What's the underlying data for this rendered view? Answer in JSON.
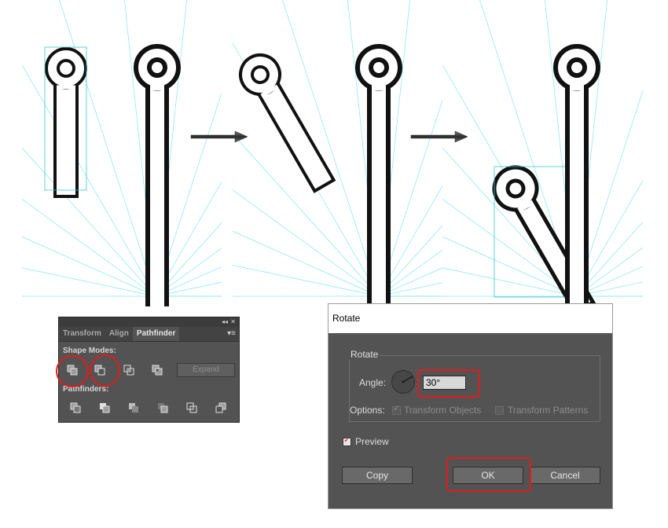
{
  "pathfinder_panel": {
    "tabs": [
      "Transform",
      "Align",
      "Pathfinder"
    ],
    "active_tab": "Pathfinder",
    "shape_modes_label": "Shape Modes:",
    "pathfinders_label": "Pathfinders:",
    "expand_label": "Expand",
    "shape_mode_icons": [
      "unite-icon",
      "minus-front-icon",
      "intersect-icon",
      "exclude-icon"
    ],
    "pathfinder_icons": [
      "divide-icon",
      "trim-icon",
      "merge-icon",
      "crop-icon",
      "outline-icon",
      "minus-back-icon"
    ]
  },
  "rotate_dialog": {
    "title": "Rotate",
    "group_label": "Rotate",
    "angle_label": "Angle:",
    "angle_value": "30°",
    "options_label": "Options:",
    "transform_objects_label": "Transform Objects",
    "transform_objects_checked": true,
    "transform_patterns_label": "Transform Patterns",
    "transform_patterns_checked": false,
    "preview_label": "Preview",
    "preview_checked": true,
    "copy_label": "Copy",
    "ok_label": "OK",
    "cancel_label": "Cancel"
  },
  "colors": {
    "guide": "#7fe8ee",
    "highlight": "#e01b1b",
    "panel_bg": "#535353",
    "selection": "#38c9d6"
  }
}
